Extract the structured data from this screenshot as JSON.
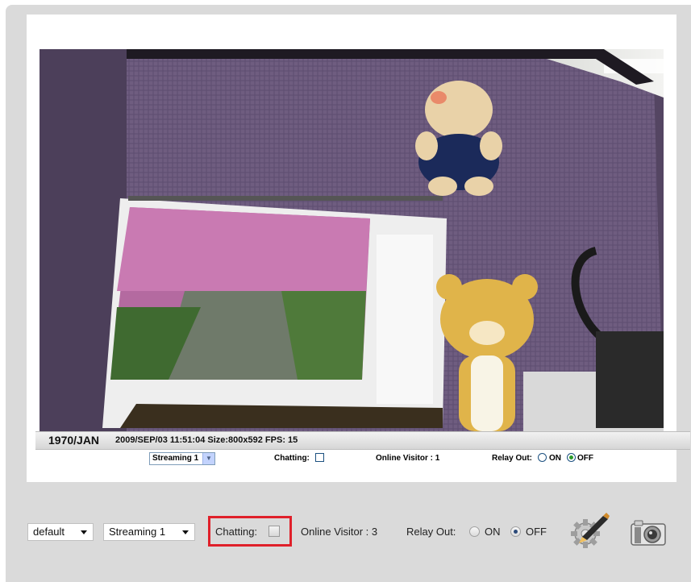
{
  "video": {
    "overlay_year": "1970/JAN",
    "overlay_info": "2009/SEP/03 11:51:04 Size:800x592 FPS: 15"
  },
  "embedded_controls": {
    "stream_select_value": "Streaming 1",
    "chatting_label": "Chatting:",
    "online_visitor_label": "Online Visitor : 1",
    "relay_out_label": "Relay Out:",
    "relay_on_label": "ON",
    "relay_off_label": "OFF",
    "relay_state": "OFF"
  },
  "toolbar": {
    "profile_select_value": "default",
    "stream_select_value": "Streaming 1",
    "chatting_label": "Chatting:",
    "chatting_checked": false,
    "online_visitor_label": "Online Visitor : 3",
    "relay_out_label": "Relay Out:",
    "relay_on_label": "ON",
    "relay_off_label": "OFF",
    "relay_state": "OFF",
    "settings_icon": "settings-wrench-icon",
    "snapshot_icon": "camera-snapshot-icon"
  },
  "colors": {
    "highlight_border": "#e0202a",
    "frame_background": "#dadada"
  }
}
